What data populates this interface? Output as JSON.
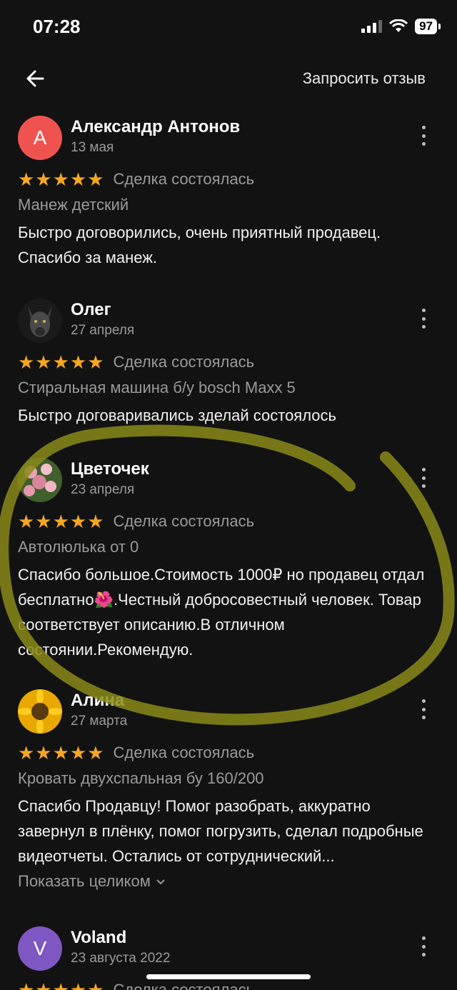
{
  "status": {
    "time": "07:28",
    "battery": "97"
  },
  "header": {
    "request_review": "Запросить отзыв"
  },
  "reviews": [
    {
      "author": "Александр Антонов",
      "initial": "А",
      "avatar_color": "#ef5350",
      "date": "13 мая",
      "stars": "★★★★★",
      "status": "Сделка состоялась",
      "item": "Манеж детский",
      "text": "Быстро договорились, очень приятный продавец. Спасибо за манеж."
    },
    {
      "author": "Олег",
      "date": "27 апреля",
      "stars": "★★★★★",
      "status": "Сделка состоялась",
      "item": "Стиральная машина б/у bosch Maxx 5",
      "text": "Быстро договаривались зделай состоялось"
    },
    {
      "author": "Цветочек",
      "date": "23 апреля",
      "stars": "★★★★★",
      "status": "Сделка состоялась",
      "item": "Автолюлька от 0",
      "text": "Спасибо большое.Стоимость 1000₽ но продавец отдал бесплатно🌺.Честный добросовестный человек. Товар соответствует описанию.В отличном состоянии.Рекомендую."
    },
    {
      "author": "Алина",
      "date": "27 марта",
      "stars": "★★★★★",
      "status": "Сделка состоялась",
      "item": "Кровать двухспальная бу 160/200",
      "text": "Спасибо Продавцу! Помог разобрать, аккуратно завернул в плёнку, помог погрузить, сделал подробные видеотчеты.  Остались от сотруднический...",
      "show_full": "Показать целиком"
    },
    {
      "author": "Voland",
      "initial": "V",
      "avatar_color": "#7e57c2",
      "date": "23 августа 2022",
      "stars": "★★★★★",
      "status": "Сделка состоялась"
    }
  ],
  "colors": {
    "background": "#121212",
    "star": "#f5a623",
    "muted": "#9a9a9a",
    "annotation": "#8a8a1a"
  }
}
